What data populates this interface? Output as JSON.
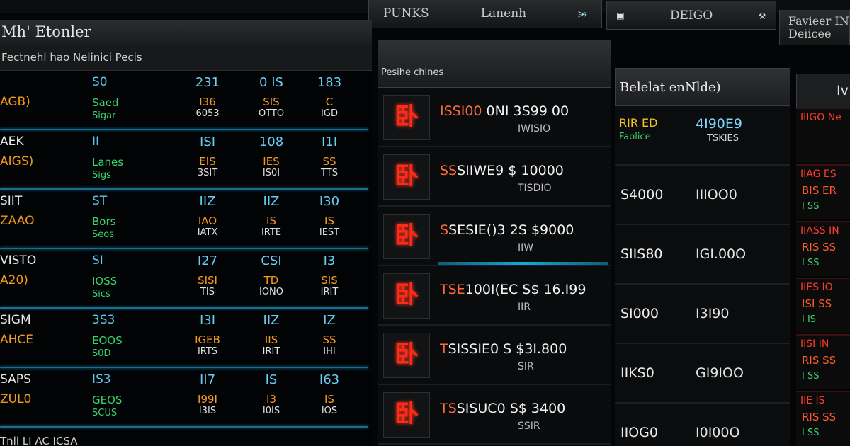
{
  "tabs": [
    {
      "label": "PUNKS",
      "icon": "cog-icon"
    },
    {
      "label": "Lanenh",
      "icon": "alert-icon"
    },
    {
      "label": "DEIGO",
      "icon": "chart-icon"
    },
    {
      "label_line1": "Favieer IN",
      "label_line2": "Deiicee"
    }
  ],
  "left": {
    "title": "Mh' Etonler",
    "subtitle": "Fectnehl hao Nelinici Pecis",
    "rows": [
      {
        "name1": "",
        "name2": "AGB)",
        "name3": "",
        "code": "S0",
        "g1": "Saed",
        "g2": "Sigar",
        "c1a": "231",
        "c1b": "I36",
        "c1c": "6053",
        "c2a": "0 IS",
        "c2b": "SIS",
        "c2c": "OTTO",
        "c3a": "183",
        "c3b": "C",
        "c3c": "IGD"
      },
      {
        "name1": "AEK",
        "name2": "AIGS)",
        "name3": "",
        "code": "II",
        "g1": "Lanes",
        "g2": "Sigs",
        "c1a": "ISI",
        "c1b": "EIS",
        "c1c": "3SIT",
        "c2a": "108",
        "c2b": "IES",
        "c2c": "IS0I",
        "c3a": "I1I",
        "c3b": "SS",
        "c3c": "TTS"
      },
      {
        "name1": "SIIT",
        "name2": "ZAAO",
        "name3": "",
        "code": "ST",
        "g1": "Bors",
        "g2": "Seos",
        "c1a": "IIZ",
        "c1b": "IAO",
        "c1c": "IATX",
        "c2a": "IIZ",
        "c2b": "IS",
        "c2c": "IRTE",
        "c3a": "I30",
        "c3b": "IS",
        "c3c": "IEST"
      },
      {
        "name1": "VISTO",
        "name2": "A20)",
        "name3": "",
        "code": "SI",
        "g1": "IOSS",
        "g2": "Sics",
        "c1a": "I27",
        "c1b": "SISI",
        "c1c": "TIS",
        "c2a": "CSI",
        "c2b": "TD",
        "c2c": "IONO",
        "c3a": "I3",
        "c3b": "SIS",
        "c3c": "IRIT"
      },
      {
        "name1": "SIGM",
        "name2": "AHCE",
        "name3": "",
        "code": "3S3",
        "g1": "EOOS",
        "g2": "S0D",
        "c1a": "I3I",
        "c1b": "IGEB",
        "c1c": "IRTS",
        "c2a": "IIZ",
        "c2b": "IIS",
        "c2c": "IRIT",
        "c3a": "IZ",
        "c3b": "SS",
        "c3c": "IHI"
      },
      {
        "name1": "SAPS",
        "name2": "ZUL0",
        "name3": "",
        "code": "IS3",
        "g1": "GEOS",
        "g2": "SCUS",
        "c1a": "II7",
        "c1b": "I99I",
        "c1c": "I3IS",
        "c2a": "IS",
        "c2b": "I3",
        "c2c": "I0IS",
        "c3a": "I63",
        "c3b": "IS",
        "c3c": "IOS"
      }
    ],
    "footer": "Tnll   LI AC   ICSA"
  },
  "middle": {
    "header_label": "Pesihe chines",
    "rows": [
      {
        "glyph": "卧",
        "price_pre": "ISSI00",
        "price": " 0NI 3S99 00",
        "sub": "IWISIO"
      },
      {
        "glyph": "卧",
        "price_pre": "SS",
        "price": "SIIWE9 $ 10000",
        "sub": "TISDIO"
      },
      {
        "glyph": "卧",
        "price_pre": "S",
        "price": "SESIE()3 2S $9000",
        "sub": "IIW"
      },
      {
        "glyph": "卧",
        "price_pre": "TSE",
        "price": "100I(EC S$ 16.I99",
        "sub": "IIR"
      },
      {
        "glyph": "卧",
        "price_pre": "T",
        "price": "SISSIE0 S $3I.800",
        "sub": "SIR"
      },
      {
        "glyph": "卧",
        "price_pre": "TS",
        "price": "SISUC0 S$ 3400",
        "sub": "SSIR"
      }
    ]
  },
  "right_center": {
    "title": "Belelat enNlde)",
    "first_row": {
      "tag": "RIR ED",
      "tag2": "Faolice",
      "value": "4I90E9",
      "sub": "TSKIES"
    },
    "rows": [
      {
        "v1": "S4000",
        "v2": "IIIOO0"
      },
      {
        "v1": "SIIS80",
        "v2": "IGI.00O"
      },
      {
        "v1": "SI000",
        "v2": "I3I90"
      },
      {
        "v1": "IIKS0",
        "v2": "GI9IOO"
      },
      {
        "v1": "IIOG0",
        "v2": "I0I00O"
      }
    ]
  },
  "far_right": {
    "title": "Iv",
    "rows": [
      {
        "t1": "IIIGO Ne",
        "t2": "",
        "t3": ""
      },
      {
        "t1": "IIAG ES",
        "t2": "BIS ER",
        "t3": "I SS"
      },
      {
        "t1": "IIASS IN",
        "t2": "RIS SS",
        "t3": "I SS"
      },
      {
        "t1": "IIES IO",
        "t2": "ISI SS",
        "t3": "I IS"
      },
      {
        "t1": "IISI IN",
        "t2": "RIS SS",
        "t3": "I SS"
      },
      {
        "t1": "IIE IS",
        "t2": "RIS SS",
        "t3": "I SS"
      }
    ]
  }
}
